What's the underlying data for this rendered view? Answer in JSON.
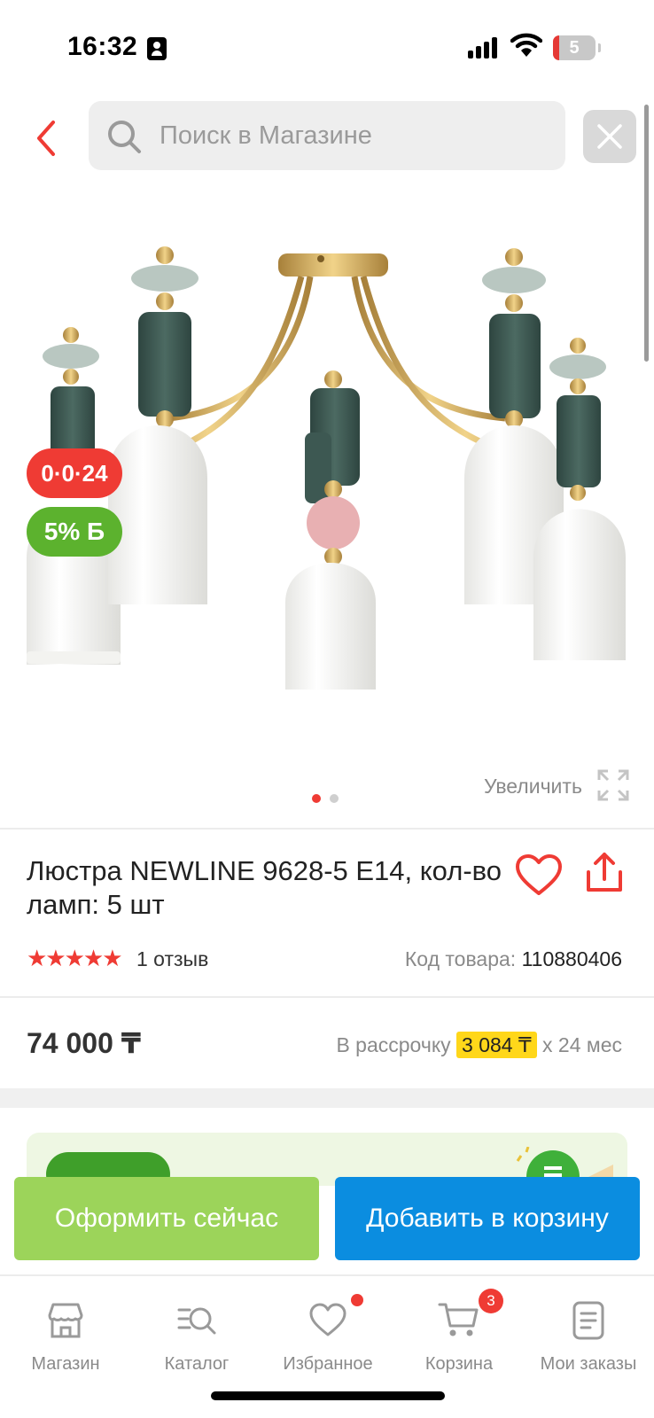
{
  "status_bar": {
    "time": "16:32",
    "battery_level": "5"
  },
  "header": {
    "search_placeholder": "Поиск в Магазине"
  },
  "product": {
    "badges": {
      "installment": "0·0·24",
      "bonus": "5% Б"
    },
    "zoom_label": "Увеличить",
    "gallery": {
      "total": 2,
      "active_index": 0
    },
    "title": "Люстра NEWLINE 9628-5 E14, кол-во ламп: 5 шт",
    "rating": {
      "stars": 5,
      "reviews_label": "1 отзыв"
    },
    "sku": {
      "label": "Код товара:",
      "value": "110880406"
    },
    "price": "74 000 ₸",
    "installment": {
      "prefix": "В рассрочку",
      "amount": "3 084 ₸",
      "suffix": "х 24 мес"
    }
  },
  "actions": {
    "checkout_label": "Оформить сейчас",
    "add_to_cart_label": "Добавить в корзину"
  },
  "bottom_nav": {
    "items": [
      {
        "label": "Магазин",
        "icon": "store-icon"
      },
      {
        "label": "Каталог",
        "icon": "catalog-search-icon"
      },
      {
        "label": "Избранное",
        "icon": "heart-icon",
        "notification_dot": true
      },
      {
        "label": "Корзина",
        "icon": "cart-icon",
        "badge": "3"
      },
      {
        "label": "Мои заказы",
        "icon": "orders-icon"
      }
    ]
  },
  "colors": {
    "accent_red": "#ef3b34",
    "bonus_green": "#5cb22e",
    "checkout_green": "#9cd45a",
    "cart_blue": "#0b8de0",
    "installment_yellow": "#ffd71a"
  }
}
